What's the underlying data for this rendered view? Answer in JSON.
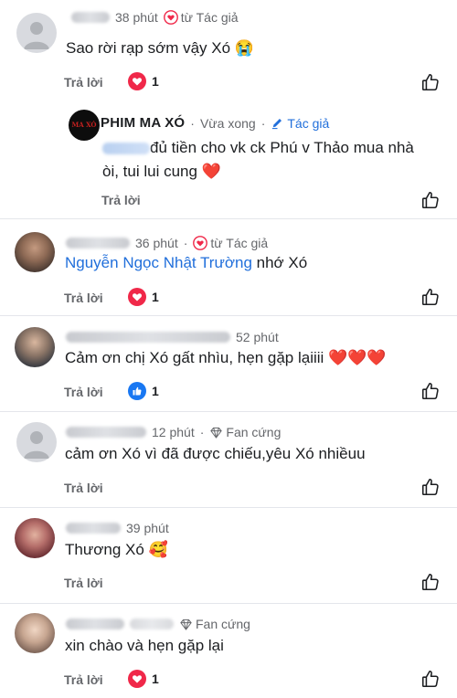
{
  "colors": {
    "heart": "#f02849",
    "like": "#1877f2",
    "link": "#216fdb",
    "meta": "#65676b",
    "divider": "#e4e6eb"
  },
  "comments": [
    {
      "time": "38 phút",
      "badge": "từ Tác giả",
      "badge_icon": "heart-outline-icon",
      "text": "Sao rời rạp sớm  vậy Xó 😭",
      "reply": "Trả lời",
      "reaction_count": "1",
      "reaction_icon": "heart-reaction-icon"
    },
    {
      "author": "PHIM MA XÓ",
      "time": "Vừa xong",
      "badge": "Tác giả",
      "badge_icon": "pencil-icon",
      "text_line1": "đủ tiền cho vk ck Phú v Thảo mua nhà",
      "text_line2": "òi, tui lui cung ❤️",
      "reply": "Trả lời",
      "avatar_text": "MA XÓ"
    },
    {
      "time": "36 phút",
      "badge": "từ Tác giả",
      "badge_icon": "heart-outline-icon",
      "mention": "Nguyễn Ngọc Nhật Trường",
      "text": "nhớ Xó",
      "reply": "Trả lời",
      "reaction_count": "1",
      "reaction_icon": "heart-reaction-icon"
    },
    {
      "time": "52 phút",
      "text": "Cảm ơn chị Xó gất nhìu, hẹn gặp lạiiii ❤️❤️❤️",
      "reply": "Trả lời",
      "reaction_count": "1",
      "reaction_icon": "like-reaction-icon"
    },
    {
      "time": "12 phút",
      "badge": "Fan cứng",
      "badge_icon": "diamond-icon",
      "text": "cảm ơn Xó vì đã được chiếu,yêu Xó nhiềuu",
      "reply": "Trả lời"
    },
    {
      "time": "39 phút",
      "text": "Thương Xó 🥰",
      "reply": "Trả lời"
    },
    {
      "badge": "Fan cứng",
      "badge_icon": "diamond-icon",
      "text": "xin chào và hẹn gặp lại",
      "reply": "Trả lời",
      "reaction_count": "1",
      "reaction_icon": "heart-reaction-icon"
    }
  ]
}
